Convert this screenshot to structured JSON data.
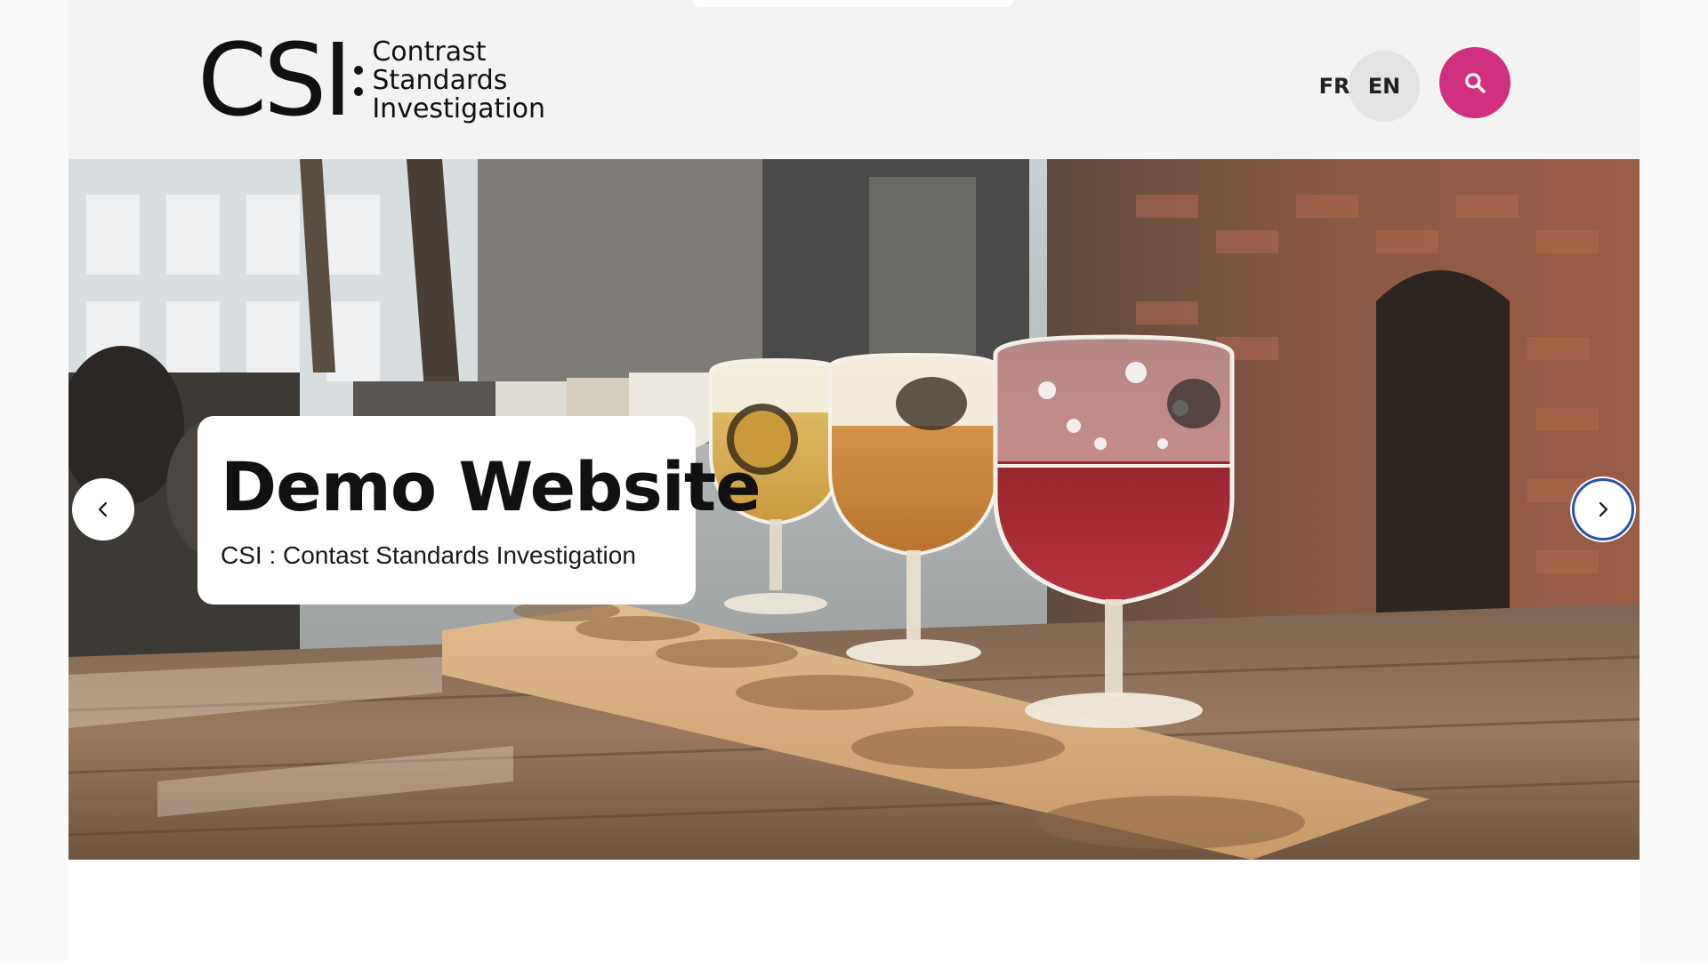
{
  "header": {
    "logo": {
      "mark": "CSI",
      "lines": [
        "Contrast",
        "Standards",
        "Investigation"
      ]
    },
    "languages": [
      {
        "label": "FR",
        "active": false
      },
      {
        "label": "EN",
        "active": true
      }
    ],
    "search_icon": "search-icon",
    "accent_color": "#d12f7f"
  },
  "hero": {
    "title": "Demo Website",
    "subtitle": "CSI : Contast Standards Investigation",
    "prev_icon": "chevron-left-icon",
    "next_icon": "chevron-right-icon",
    "image_subject": "beer-flight-photo"
  }
}
